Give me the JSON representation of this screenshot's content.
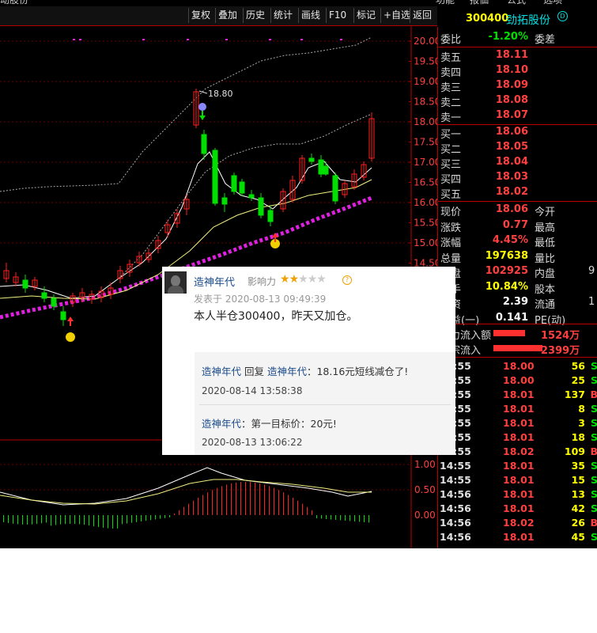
{
  "topbar": {
    "left_text": "动股份",
    "menu": [
      "功能",
      "报価",
      "公式",
      "选项"
    ]
  },
  "toolbar": {
    "buttons": [
      "复权",
      "叠加",
      "历史",
      "统计",
      "画线",
      "F10",
      "标记",
      "+自选",
      "返回"
    ]
  },
  "ticker": {
    "code": "300400",
    "name": "劲拓股份",
    "tag": "D"
  },
  "chart": {
    "price_axis": [
      "20.00",
      "19.50",
      "19.00",
      "18.50",
      "18.00",
      "17.50",
      "17.00",
      "16.50",
      "16.00",
      "15.50",
      "15.00",
      "14.50"
    ],
    "peak_label": "18.80",
    "macd_axis": [
      "1.00",
      "0.50",
      "0.00"
    ],
    "colors": {
      "up": "#ff2020",
      "down": "#00e000",
      "ma_white": "#ffffff",
      "ma_yellow": "#f0f080",
      "band": "#bbbbbb",
      "magenta": "#e020e0"
    }
  },
  "quote": {
    "weibi": {
      "label": "委比",
      "value": "-1.20%",
      "right": "委差"
    },
    "asks": [
      {
        "label": "卖五",
        "price": "18.11"
      },
      {
        "label": "卖四",
        "price": "18.10"
      },
      {
        "label": "卖三",
        "price": "18.09"
      },
      {
        "label": "卖二",
        "price": "18.08"
      },
      {
        "label": "卖一",
        "price": "18.07"
      }
    ],
    "bids": [
      {
        "label": "买一",
        "price": "18.06"
      },
      {
        "label": "买二",
        "price": "18.05"
      },
      {
        "label": "买三",
        "price": "18.04"
      },
      {
        "label": "买四",
        "price": "18.03"
      },
      {
        "label": "买五",
        "price": "18.02"
      }
    ],
    "stats": [
      {
        "label": "现价",
        "value": "18.06",
        "right": "今开",
        "color": "#ff4040"
      },
      {
        "label": "涨跌",
        "value": "0.77",
        "right": "最高",
        "color": "#ff4040"
      },
      {
        "label": "涨幅",
        "value": "4.45%",
        "right": "最低",
        "color": "#ff4040"
      },
      {
        "label": "总量",
        "value": "197638",
        "right": "量比",
        "color": "#ffff00"
      },
      {
        "label": "外盘",
        "value": "102925",
        "right": "内盘",
        "color": "#ff4040"
      },
      {
        "label": "换手",
        "value": "10.84%",
        "right": "股本",
        "color": "#ffff00"
      },
      {
        "label": "净资",
        "value": "2.39",
        "right": "流通",
        "color": "#ffffff"
      },
      {
        "label": "收益(一)",
        "value": "0.141",
        "right": "PE(动)",
        "color": "#ffffff"
      }
    ],
    "stat_right_values": [
      "",
      "",
      "",
      "",
      "9",
      "",
      "1",
      ""
    ],
    "flows": [
      {
        "label": "主力流入额",
        "value": "1524万"
      },
      {
        "label": "大宗流入",
        "value": "2399万"
      }
    ],
    "ticks": [
      {
        "time": "14:55",
        "price": "18.00",
        "qty": "56",
        "side": "S"
      },
      {
        "time": "14:55",
        "price": "18.00",
        "qty": "25",
        "side": "S"
      },
      {
        "time": "14:55",
        "price": "18.01",
        "qty": "137",
        "side": "B"
      },
      {
        "time": "14:55",
        "price": "18.01",
        "qty": "8",
        "side": "S"
      },
      {
        "time": "14:55",
        "price": "18.01",
        "qty": "3",
        "side": "S"
      },
      {
        "time": "14:55",
        "price": "18.01",
        "qty": "18",
        "side": "S"
      },
      {
        "time": "14:55",
        "price": "18.02",
        "qty": "109",
        "side": "B"
      },
      {
        "time": "14:55",
        "price": "18.01",
        "qty": "35",
        "side": "S"
      },
      {
        "time": "14:55",
        "price": "18.01",
        "qty": "15",
        "side": "S"
      },
      {
        "time": "14:56",
        "price": "18.01",
        "qty": "13",
        "side": "S"
      },
      {
        "time": "14:56",
        "price": "18.01",
        "qty": "42",
        "side": "S"
      },
      {
        "time": "14:56",
        "price": "18.02",
        "qty": "26",
        "side": "B"
      },
      {
        "time": "14:56",
        "price": "18.01",
        "qty": "45",
        "side": "S"
      }
    ]
  },
  "popup": {
    "username": "造神年代",
    "influence_label": "影响力",
    "stars_on": 2,
    "stars_total": 5,
    "posted": "发表于 2020-08-13 09:49:39",
    "content": "本人半仓300400，昨天又加仓。",
    "replies": [
      {
        "user": "造神年代",
        "mid": " 回复 ",
        "target": "造神年代",
        "text": "：18.16元短线减仓了!",
        "date": "2020-08-14 13:58:38"
      },
      {
        "user": "造神年代",
        "mid": "",
        "target": "",
        "text": "：第一目标价：20元!",
        "date": "2020-08-13 13:06:22"
      }
    ]
  }
}
